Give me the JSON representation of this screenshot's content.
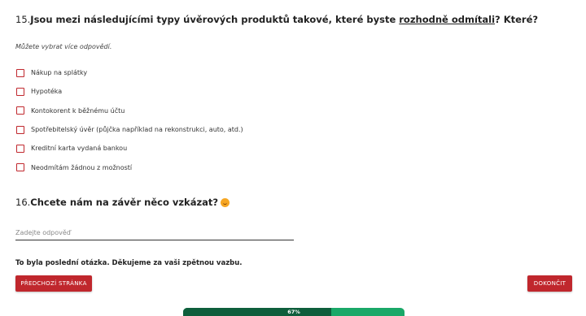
{
  "q15": {
    "number": "15.",
    "title_start": "Jsou mezi následujícími typy úvěrových produktů takové, které byste ",
    "title_emph": "rozhodně odmítali",
    "title_end": "? Které?",
    "hint": "Můžete vybrat více odpovědí.",
    "options": [
      {
        "label": "Nákup na splátky",
        "checked": false
      },
      {
        "label": "Hypotéka",
        "checked": false
      },
      {
        "label": "Kontokorent k běžnému účtu",
        "checked": false
      },
      {
        "label": "Spotřebitelský úvěr (půjčka například na rekonstrukci, auto, atd.)",
        "checked": false
      },
      {
        "label": "Kreditní karta vydaná bankou",
        "checked": false
      },
      {
        "label": "Neodmítám žádnou z možností",
        "checked": false
      }
    ]
  },
  "q16": {
    "number": "16.",
    "title": "Chcete nám na závěr něco vzkázat?",
    "icon": "smiling-face-emoji-icon",
    "placeholder": "Zadejte odpověď",
    "value": ""
  },
  "final_note": "To byla poslední otázka. Děkujeme za vaši zpětnou vazbu.",
  "buttons": {
    "prev": "PŘEDCHOZÍ STRÁNKA",
    "finish": "DOKONČIT"
  },
  "progress": {
    "percent": 67,
    "label": "67%"
  },
  "colors": {
    "accent_red": "#c0272d",
    "progress_dark": "#0e5e3c",
    "progress_light": "#1aa868"
  }
}
